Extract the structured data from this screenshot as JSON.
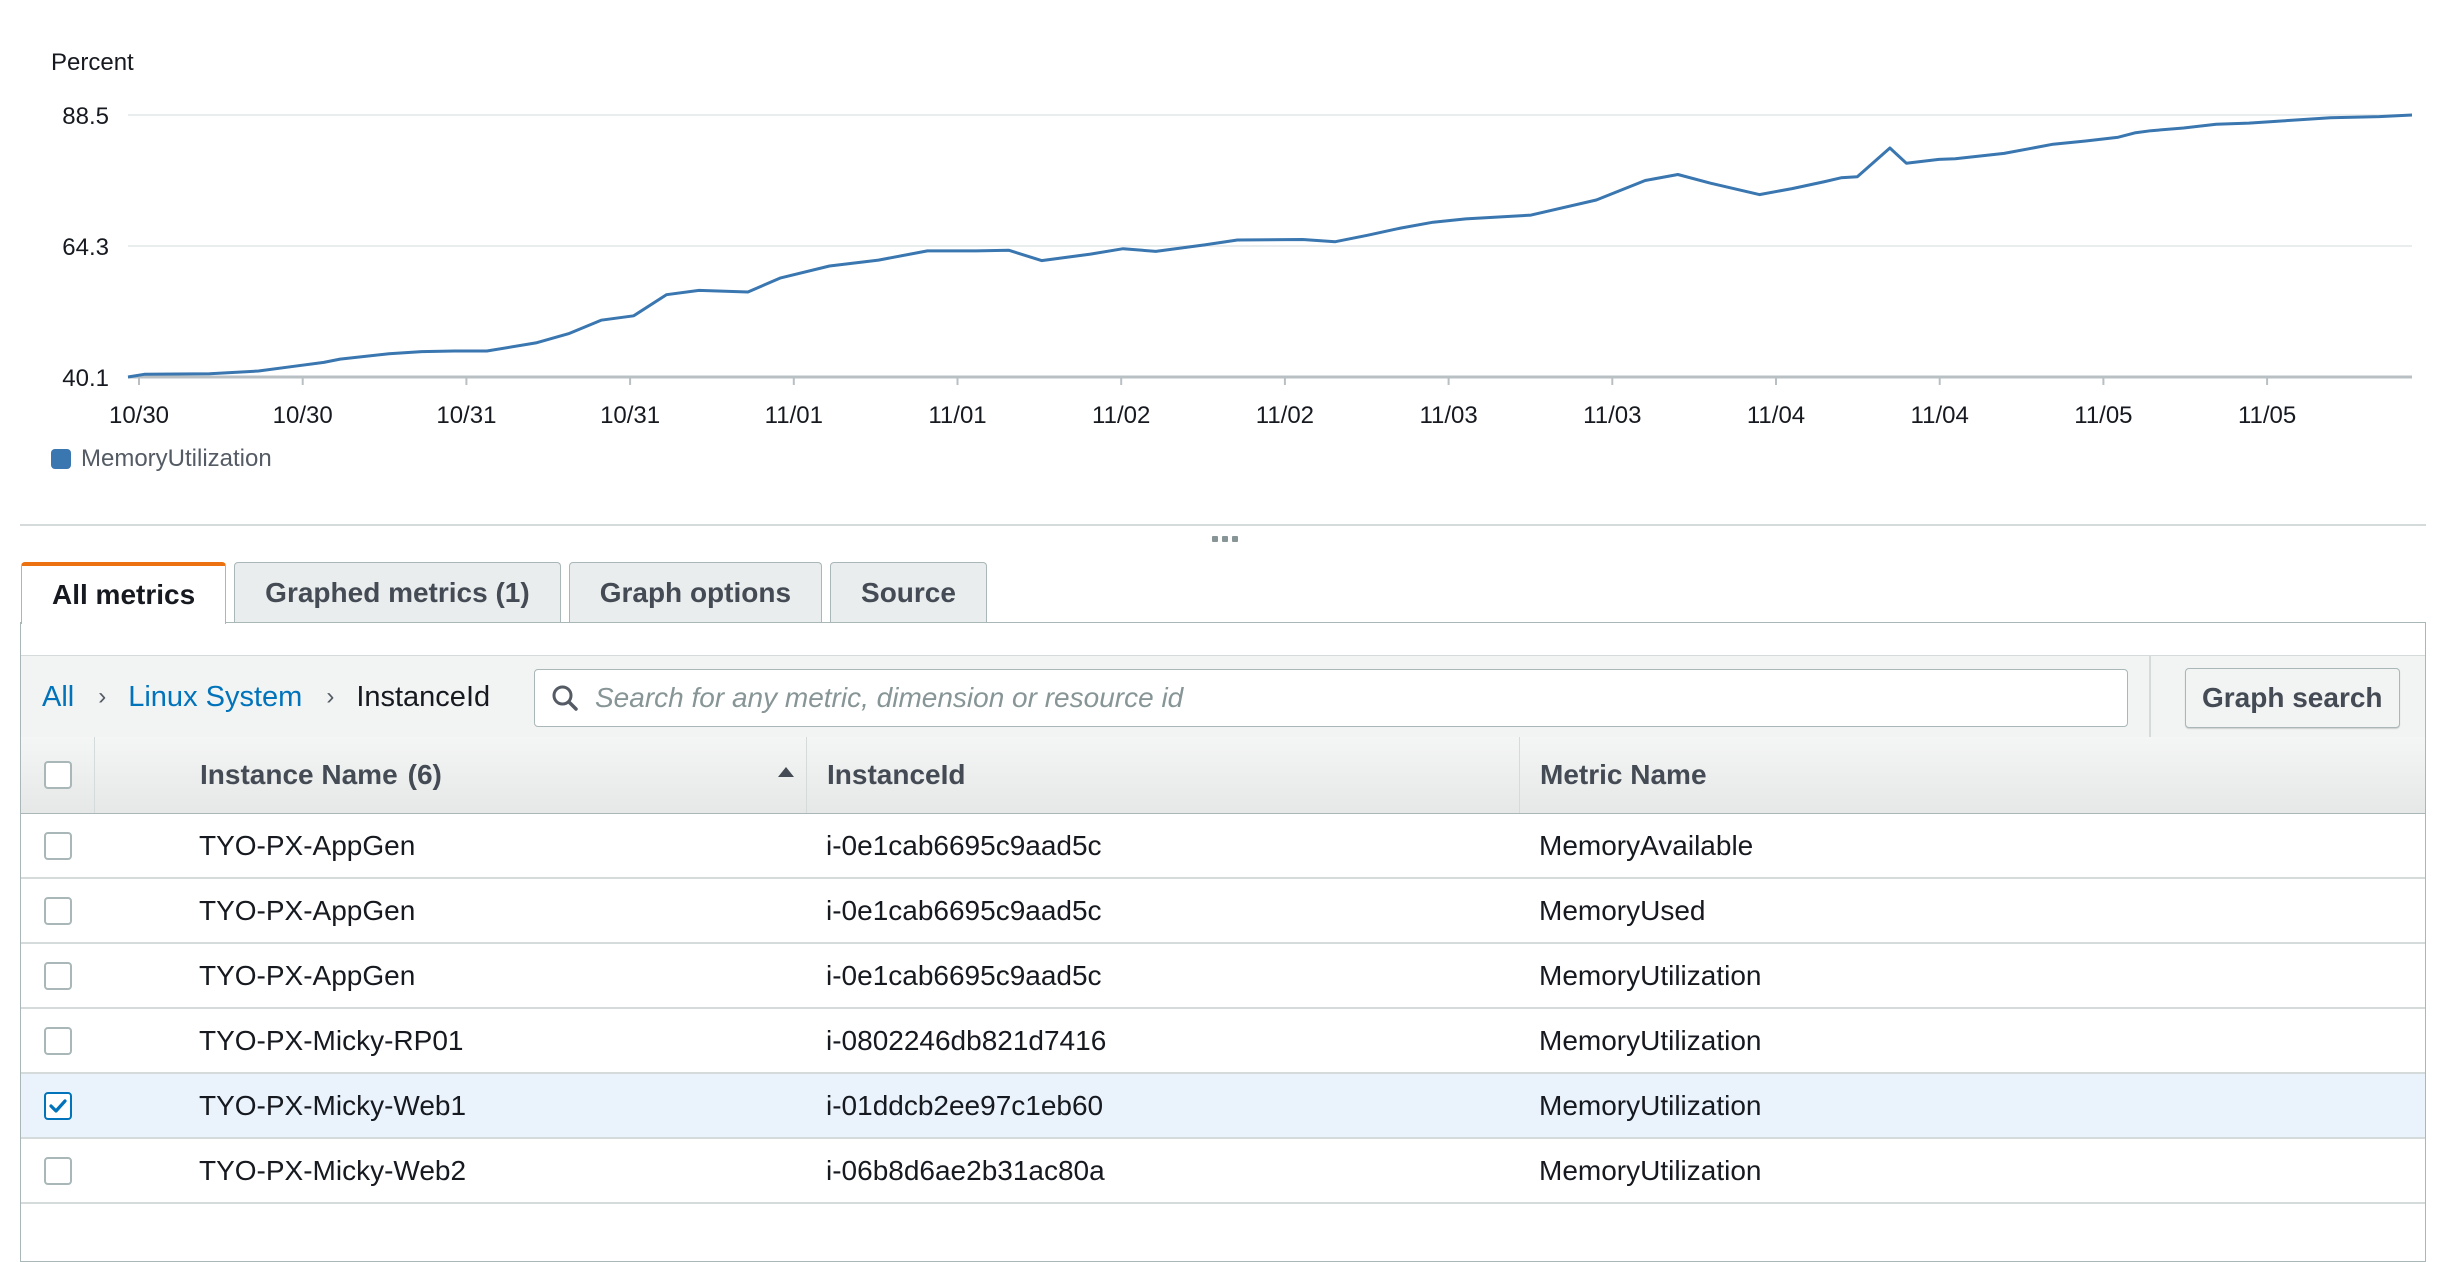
{
  "chart": {
    "ylabel": "Percent",
    "legend_color": "#3a76af",
    "line_color": "#3a76af"
  },
  "chart_data": {
    "type": "line",
    "title": "",
    "ylabel": "Percent",
    "xlabel": "",
    "ylim": [
      40.1,
      88.5
    ],
    "yticks": [
      40.1,
      64.3,
      88.5
    ],
    "xtick_labels": [
      "10/30",
      "10/30",
      "10/31",
      "10/31",
      "11/01",
      "11/01",
      "11/02",
      "11/02",
      "11/03",
      "11/03",
      "11/04",
      "11/04",
      "11/05",
      "11/05"
    ],
    "x_range": [
      0,
      14
    ],
    "grid": "horizontal",
    "legend_placement": "bottom-left",
    "series": [
      {
        "name": "MemoryUtilization",
        "color": "#3a76af",
        "x": [
          0,
          0.1,
          0.5,
          0.8,
          1.0,
          1.2,
          1.3,
          1.6,
          1.8,
          2.0,
          2.2,
          2.5,
          2.7,
          2.9,
          3.1,
          3.3,
          3.5,
          3.8,
          4.0,
          4.3,
          4.6,
          4.9,
          5.2,
          5.4,
          5.6,
          5.9,
          6.1,
          6.3,
          6.6,
          6.8,
          7.2,
          7.4,
          7.6,
          7.8,
          8.0,
          8.2,
          8.6,
          9.0,
          9.3,
          9.5,
          9.7,
          10.0,
          10.2,
          10.4,
          10.5,
          10.6,
          10.8,
          10.9,
          11.1,
          11.2,
          11.5,
          11.8,
          12.0,
          12.2,
          12.3,
          12.4,
          12.6,
          12.8,
          13.0,
          13.3,
          13.5,
          13.8,
          14.0
        ],
        "values": [
          40.1,
          40.6,
          40.7,
          41.2,
          42.0,
          42.8,
          43.4,
          44.4,
          44.8,
          44.9,
          44.9,
          46.4,
          48.1,
          50.6,
          51.4,
          55.3,
          56.1,
          55.8,
          58.4,
          60.6,
          61.7,
          63.4,
          63.4,
          63.5,
          61.6,
          62.8,
          63.8,
          63.3,
          64.5,
          65.4,
          65.5,
          65.1,
          66.3,
          67.6,
          68.7,
          69.3,
          70.0,
          72.8,
          76.4,
          77.5,
          75.9,
          73.8,
          74.9,
          76.2,
          76.9,
          77.1,
          82.4,
          79.6,
          80.3,
          80.4,
          81.4,
          83.1,
          83.7,
          84.4,
          85.2,
          85.6,
          86.1,
          86.8,
          87.0,
          87.6,
          88.0,
          88.2,
          88.5
        ]
      }
    ]
  },
  "tabs": [
    {
      "label": "All metrics",
      "active": true
    },
    {
      "label": "Graphed metrics (1)",
      "active": false
    },
    {
      "label": "Graph options",
      "active": false
    },
    {
      "label": "Source",
      "active": false
    }
  ],
  "breadcrumb": {
    "all": "All",
    "level1": "Linux System",
    "current": "InstanceId"
  },
  "search": {
    "placeholder": "Search for any metric, dimension or resource id",
    "value": ""
  },
  "graph_search_label": "Graph search",
  "table": {
    "columns": {
      "name": "Instance Name",
      "name_count": "(6)",
      "id": "InstanceId",
      "metric": "Metric Name"
    },
    "rows": [
      {
        "name": "TYO-PX-AppGen",
        "id": "i-0e1cab6695c9aad5c",
        "metric": "MemoryAvailable",
        "checked": false
      },
      {
        "name": "TYO-PX-AppGen",
        "id": "i-0e1cab6695c9aad5c",
        "metric": "MemoryUsed",
        "checked": false
      },
      {
        "name": "TYO-PX-AppGen",
        "id": "i-0e1cab6695c9aad5c",
        "metric": "MemoryUtilization",
        "checked": false
      },
      {
        "name": "TYO-PX-Micky-RP01",
        "id": "i-0802246db821d7416",
        "metric": "MemoryUtilization",
        "checked": false
      },
      {
        "name": "TYO-PX-Micky-Web1",
        "id": "i-01ddcb2ee97c1eb60",
        "metric": "MemoryUtilization",
        "checked": true
      },
      {
        "name": "TYO-PX-Micky-Web2",
        "id": "i-06b8d6ae2b31ac80a",
        "metric": "MemoryUtilization",
        "checked": false
      }
    ]
  }
}
